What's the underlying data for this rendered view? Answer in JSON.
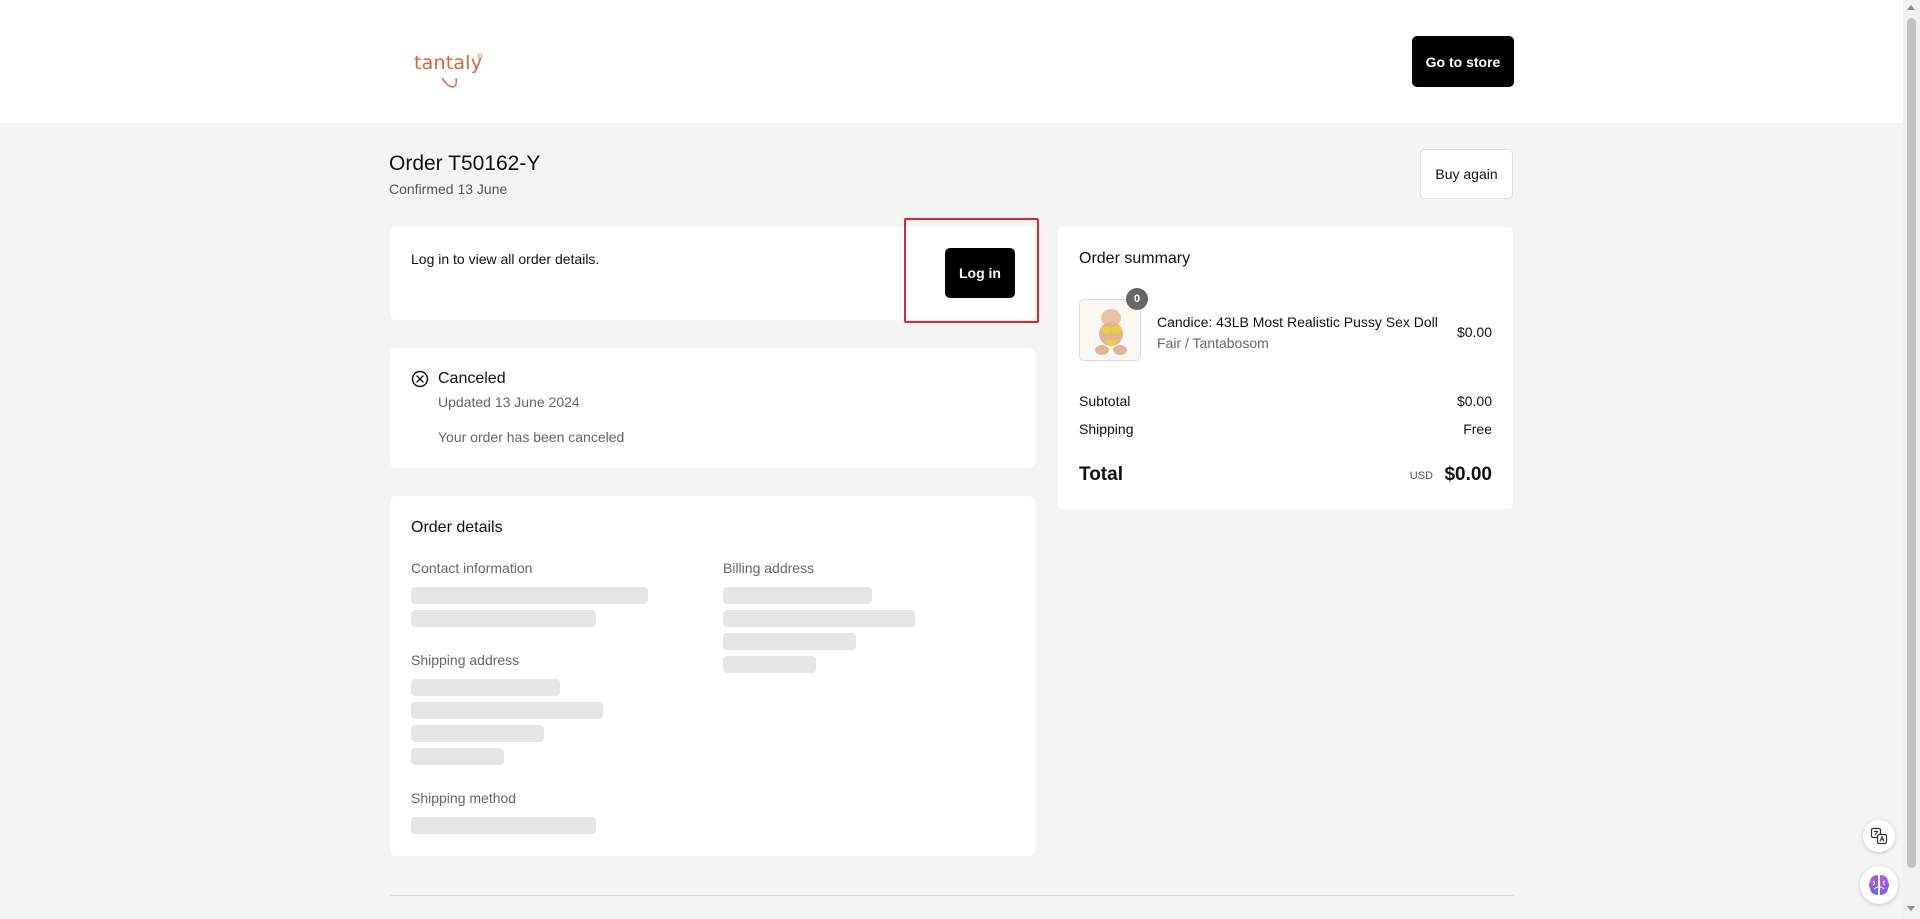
{
  "header": {
    "logo_text": "tantaly",
    "store_button": "Go to store"
  },
  "order": {
    "title": "Order T50162-Y",
    "confirmed": "Confirmed 13 June",
    "buy_again": "Buy again"
  },
  "login_card": {
    "message": "Log in to view all order details.",
    "button": "Log in"
  },
  "status_card": {
    "title": "Canceled",
    "updated": "Updated 13 June 2024",
    "message": "Your order has been canceled"
  },
  "details_card": {
    "title": "Order details",
    "contact_label": "Contact information",
    "billing_label": "Billing address",
    "shipping_address_label": "Shipping address",
    "shipping_method_label": "Shipping method"
  },
  "summary": {
    "title": "Order summary",
    "item": {
      "quantity": "0",
      "name": "Candice: 43LB Most Realistic Pussy Sex Doll",
      "variant": "Fair / Tantabosom",
      "price": "$0.00"
    },
    "subtotal_label": "Subtotal",
    "subtotal_value": "$0.00",
    "shipping_label": "Shipping",
    "shipping_value": "Free",
    "total_label": "Total",
    "currency": "USD",
    "total_value": "$0.00"
  },
  "colors": {
    "brand": "#d9653b",
    "highlight": "#e0242a",
    "button_dark": "#000000"
  },
  "icons": [
    "logo-icon",
    "cancel-circle-icon",
    "translate-icon",
    "brain-icon"
  ]
}
